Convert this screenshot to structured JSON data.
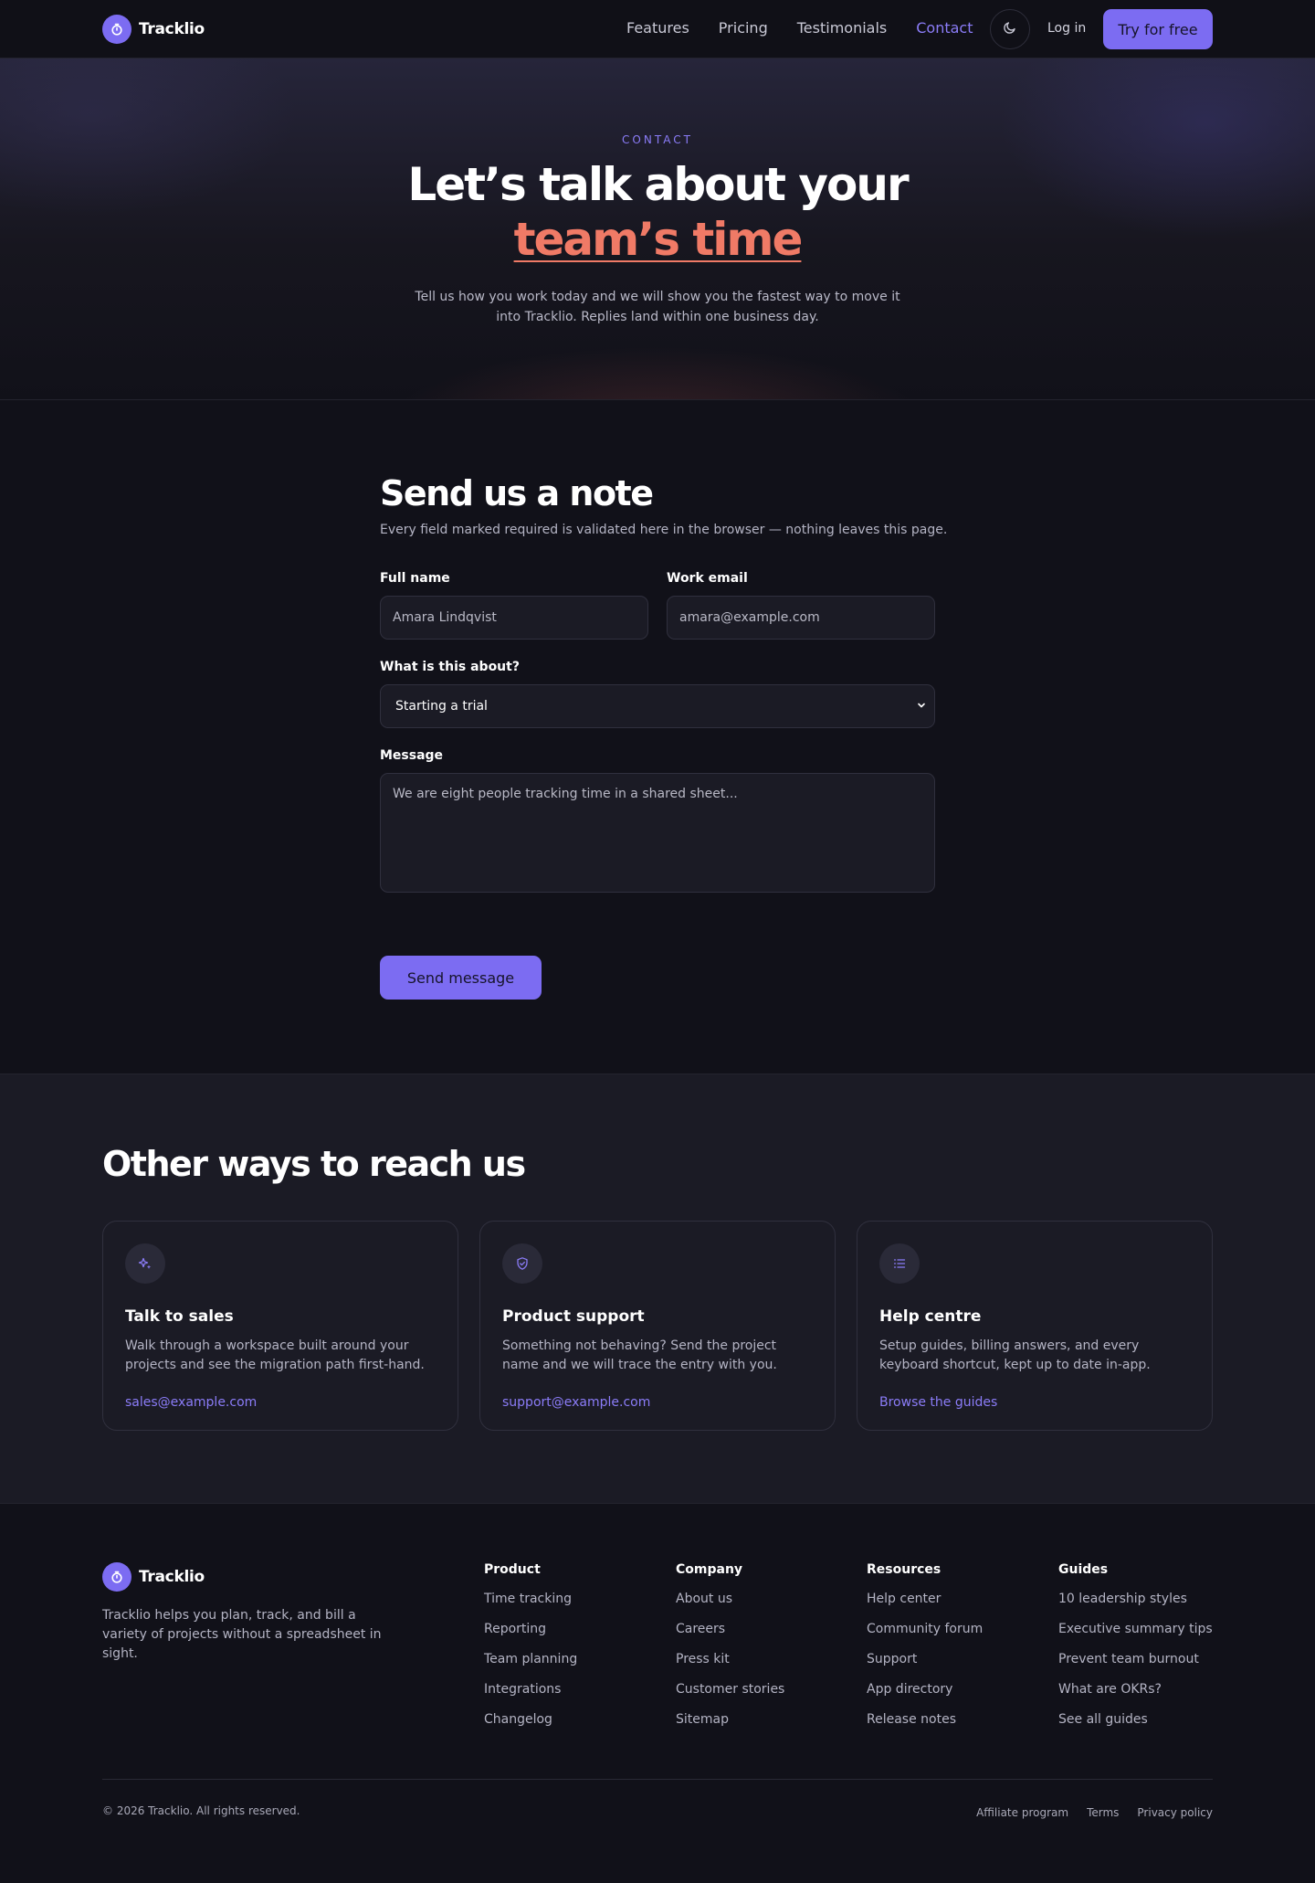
{
  "brand": {
    "name": "Tracklio",
    "logo_icon": "stopwatch-icon",
    "accent": "#7c6cf2",
    "highlight": "#f07a66"
  },
  "nav": {
    "links": [
      "Features",
      "Pricing",
      "Testimonials",
      "Contact"
    ],
    "active": "Contact",
    "theme_icon": "moon-icon",
    "login": "Log in",
    "cta": "Try for free"
  },
  "hero": {
    "eyebrow": "CONTACT",
    "title_plain": "Let’s talk about your",
    "title_highlight": "team’s time",
    "subtitle": "Tell us how you work today and we will show you the fastest way to move it into Tracklio. Replies land within one business day."
  },
  "form": {
    "title": "Send us a note",
    "note": "Every field marked required is validated here in the browser — nothing leaves this page.",
    "name_label": "Full name",
    "name_placeholder": "Amara Lindqvist",
    "email_label": "Work email",
    "email_placeholder": "amara@example.com",
    "topic_label": "What is this about?",
    "topic_value": "Starting a trial",
    "message_label": "Message",
    "message_placeholder": "We are eight people tracking time in a shared sheet...",
    "submit": "Send message"
  },
  "ways": {
    "title": "Other ways to reach us",
    "cards": [
      {
        "icon": "sparkles-icon",
        "title": "Talk to sales",
        "text": "Walk through a workspace built around your projects and see the migration path first-hand.",
        "link": "sales@example.com"
      },
      {
        "icon": "shield-check-icon",
        "title": "Product support",
        "text": "Something not behaving? Send the project name and we will trace the entry with you.",
        "link": "support@example.com"
      },
      {
        "icon": "list-icon",
        "title": "Help centre",
        "text": "Setup guides, billing answers, and every keyboard shortcut, kept up to date in-app.",
        "link": "Browse the guides"
      }
    ]
  },
  "footer": {
    "description": "Tracklio helps you plan, track, and bill a variety of projects without a spreadsheet in sight.",
    "columns": [
      {
        "title": "Product",
        "links": [
          "Time tracking",
          "Reporting",
          "Team planning",
          "Integrations",
          "Changelog"
        ]
      },
      {
        "title": "Company",
        "links": [
          "About us",
          "Careers",
          "Press kit",
          "Customer stories",
          "Sitemap"
        ]
      },
      {
        "title": "Resources",
        "links": [
          "Help center",
          "Community forum",
          "Support",
          "App directory",
          "Release notes"
        ]
      },
      {
        "title": "Guides",
        "links": [
          "10 leadership styles",
          "Executive summary tips",
          "Prevent team burnout",
          "What are OKRs?",
          "See all guides"
        ]
      }
    ],
    "copyright": "© 2026 Tracklio. All rights reserved.",
    "legal": [
      "Affiliate program",
      "Terms",
      "Privacy policy"
    ]
  }
}
